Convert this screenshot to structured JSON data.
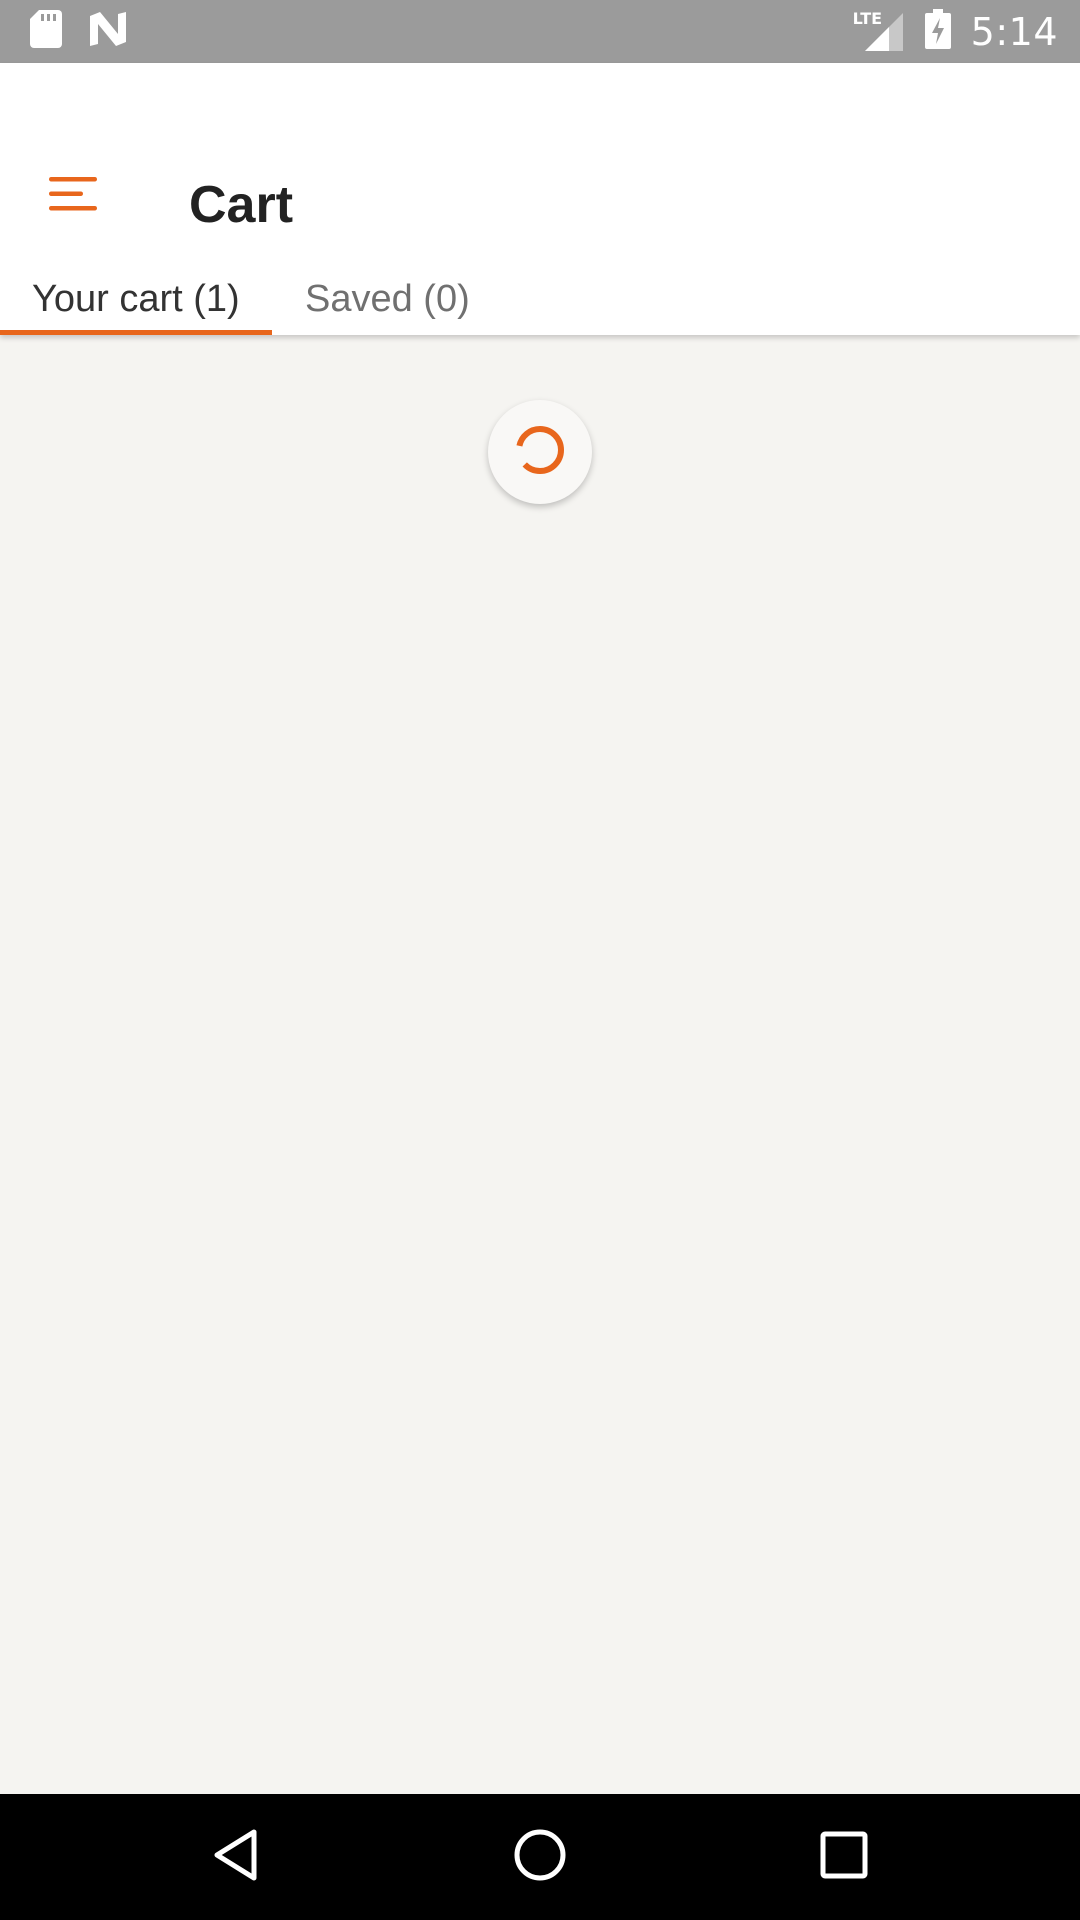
{
  "status_bar": {
    "time": "5:14",
    "network": "LTE",
    "icons": [
      "sd-card-icon",
      "n-logo-icon",
      "signal-icon",
      "battery-charging-icon"
    ]
  },
  "app_bar": {
    "title": "Cart",
    "menu_icon": "hamburger-menu-icon"
  },
  "tabs": [
    {
      "label": "Your cart (1)",
      "selected": true
    },
    {
      "label": "Saved (0)",
      "selected": false
    }
  ],
  "content": {
    "state": "loading",
    "spinner_icon": "loading-spinner-icon"
  },
  "nav_bar": {
    "buttons": [
      "back-icon",
      "home-icon",
      "recents-icon"
    ]
  },
  "colors": {
    "accent": "#e8661c",
    "status_bar": "#9b9b9b",
    "background": "#f5f4f1",
    "app_bar": "#ffffff",
    "nav_bar": "#000000"
  }
}
